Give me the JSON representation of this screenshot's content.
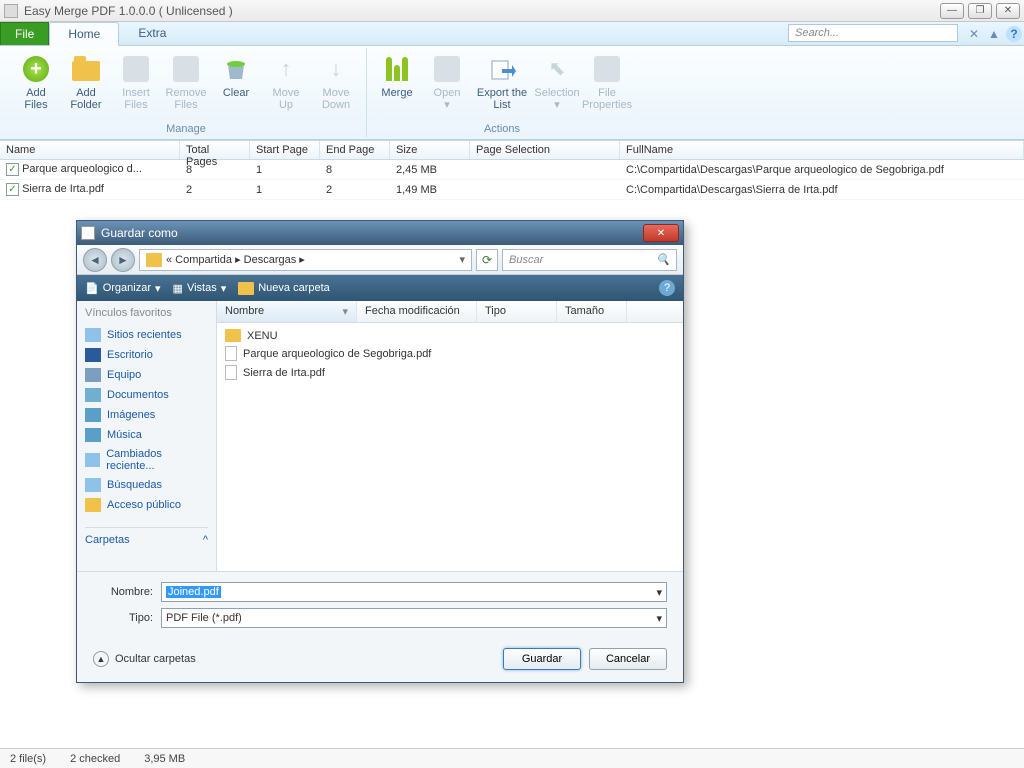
{
  "window": {
    "title": "Easy Merge PDF 1.0.0.0  ( Unlicensed )"
  },
  "tabs": {
    "file": "File",
    "home": "Home",
    "extra": "Extra"
  },
  "search": {
    "placeholder": "Search..."
  },
  "ribbon": {
    "manage_label": "Manage",
    "actions_label": "Actions",
    "add_files": "Add\nFiles",
    "add_folder": "Add\nFolder",
    "insert_files": "Insert\nFiles",
    "remove_files": "Remove\nFiles",
    "clear": "Clear",
    "move_up": "Move\nUp",
    "move_down": "Move\nDown",
    "merge": "Merge",
    "open": "Open\n▾",
    "export": "Export the\nList",
    "selection": "Selection\n▾",
    "file_props": "File\nProperties"
  },
  "grid": {
    "headers": {
      "name": "Name",
      "total_pages": "Total Pages",
      "start_page": "Start Page",
      "end_page": "End Page",
      "size": "Size",
      "page_selection": "Page Selection",
      "fullname": "FullName"
    },
    "rows": [
      {
        "name": "Parque  arqueologico  d...",
        "tp": "8",
        "sp": "1",
        "ep": "8",
        "size": "2,45 MB",
        "full": "C:\\Compartida\\Descargas\\Parque arqueologico de Segobriga.pdf"
      },
      {
        "name": "Sierra de Irta.pdf",
        "tp": "2",
        "sp": "1",
        "ep": "2",
        "size": "1,49 MB",
        "full": "C:\\Compartida\\Descargas\\Sierra de Irta.pdf"
      }
    ]
  },
  "dialog": {
    "title": "Guardar como",
    "path_prefix": "«  Compartida  ▸  Descargas  ▸",
    "search_placeholder": "Buscar",
    "toolbar": {
      "organize": "Organizar",
      "views": "Vistas",
      "new_folder": "Nueva carpeta"
    },
    "favorites_header": "Vínculos favoritos",
    "favorites": [
      "Sitios recientes",
      "Escritorio",
      "Equipo",
      "Documentos",
      "Imágenes",
      "Música",
      "Cambiados reciente...",
      "Búsquedas",
      "Acceso público"
    ],
    "carpetas": "Carpetas",
    "file_headers": {
      "name": "Nombre",
      "modified": "Fecha modificación",
      "type": "Tipo",
      "size": "Tamaño"
    },
    "files": [
      "XENU",
      "Parque arqueologico de Segobriga.pdf",
      "Sierra de Irta.pdf"
    ],
    "name_label": "Nombre:",
    "name_value": "Joined.pdf",
    "type_label": "Tipo:",
    "type_value": "PDF File (*.pdf)",
    "hide_folders": "Ocultar carpetas",
    "save": "Guardar",
    "cancel": "Cancelar"
  },
  "status": {
    "files": "2 file(s)",
    "checked": "2 checked",
    "size": "3,95 MB"
  }
}
